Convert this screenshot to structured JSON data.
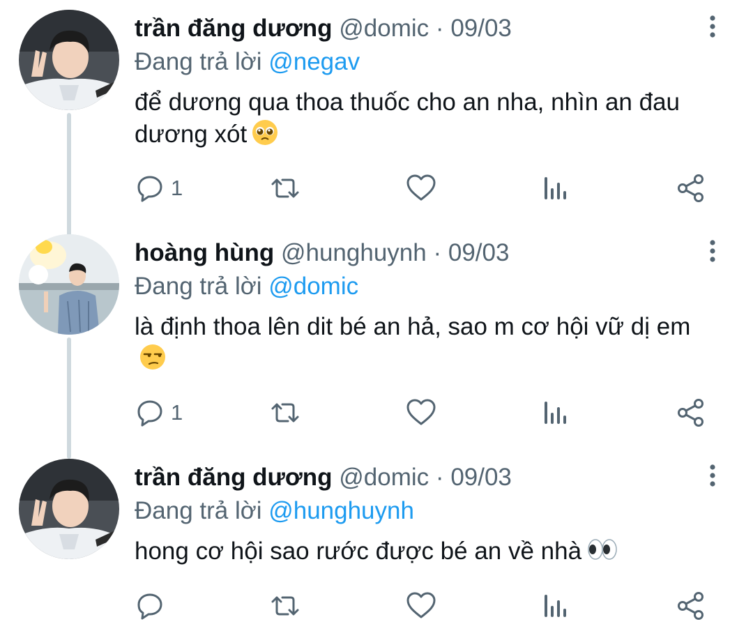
{
  "tweets": [
    {
      "display_name": "trần đăng dương",
      "handle": "@domic",
      "separator": "·",
      "date": "09/03",
      "replying_prefix": "Đang trả lời",
      "replying_to": "@negav",
      "text": "để dương qua thoa thuốc cho an nha, nhìn an đau dương xót",
      "emoji": "pleading-face",
      "reply_count": "1",
      "avatar": "avatar-man-peace-sign"
    },
    {
      "display_name": "hoàng hùng",
      "handle": "@hunghuynh",
      "separator": "·",
      "date": "09/03",
      "replying_prefix": "Đang trả lời",
      "replying_to": "@domic",
      "text": "là định thoa lên dit bé an hả, sao m cơ hội vữ dị em",
      "emoji": "unamused-face",
      "reply_count": "1",
      "avatar": "avatar-man-balloon-lake"
    },
    {
      "display_name": "trần đăng dương",
      "handle": "@domic",
      "separator": "·",
      "date": "09/03",
      "replying_prefix": "Đang trả lời",
      "replying_to": "@hunghuynh",
      "text": "hong cơ hội sao rước được bé an về nhà",
      "emoji": "eyes",
      "reply_count": "",
      "avatar": "avatar-man-peace-sign"
    }
  ],
  "colors": {
    "text": "#0f1419",
    "muted": "#536471",
    "link": "#1d9bf0",
    "thread_line": "#cfd9de"
  }
}
